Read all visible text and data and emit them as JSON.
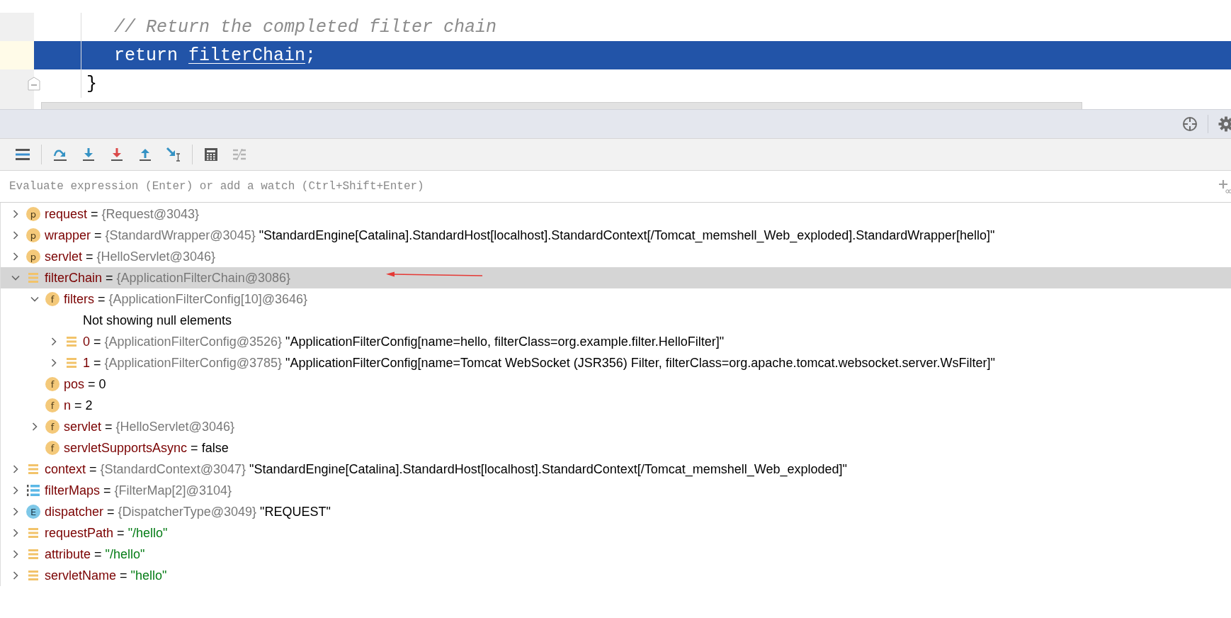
{
  "editor": {
    "lines": [
      {
        "selected": false,
        "segments": [
          {
            "kind": "comment",
            "text": "// Return the completed filter chain"
          }
        ]
      },
      {
        "selected": true,
        "segments": [
          {
            "kind": "keyword",
            "text": "return"
          },
          {
            "kind": "reference",
            "text": "filterChain"
          },
          {
            "kind": "plain",
            "text": ";"
          }
        ]
      },
      {
        "selected": false,
        "segments": [
          {
            "kind": "brace",
            "text": "}"
          }
        ]
      }
    ]
  },
  "evaluate": {
    "placeholder": "Evaluate expression (Enter) or add a watch (Ctrl+Shift+Enter)"
  },
  "variables": [
    {
      "kind": "parameter",
      "badge": "p",
      "name": "request",
      "operator": "=",
      "type_ref": "{Request@3043}",
      "expandable": true,
      "expanded": false,
      "selected": false
    },
    {
      "kind": "parameter",
      "badge": "p",
      "name": "wrapper",
      "operator": "=",
      "type_ref": "{StandardWrapper@3045}",
      "value": "\"StandardEngine[Catalina].StandardHost[localhost].StandardContext[/Tomcat_memshell_Web_exploded].StandardWrapper[hello]\"",
      "expandable": true,
      "expanded": false,
      "selected": false
    },
    {
      "kind": "parameter",
      "badge": "p",
      "name": "servlet",
      "operator": "=",
      "type_ref": "{HelloServlet@3046}",
      "expandable": true,
      "expanded": false,
      "selected": false
    },
    {
      "kind": "object",
      "name": "filterChain",
      "operator": "=",
      "type_ref": "{ApplicationFilterChain@3086}",
      "expandable": true,
      "expanded": true,
      "selected": true,
      "children": [
        {
          "kind": "field",
          "badge": "f",
          "name": "filters",
          "operator": "=",
          "type_ref": "{ApplicationFilterConfig[10]@3646}",
          "expandable": true,
          "expanded": true,
          "selected": false,
          "children": [
            {
              "kind": "note",
              "note": "Not showing null elements",
              "expandable": false,
              "selected": false
            },
            {
              "kind": "object",
              "name": "0",
              "operator": "=",
              "type_ref": "{ApplicationFilterConfig@3526}",
              "value": "\"ApplicationFilterConfig[name=hello, filterClass=org.example.filter.HelloFilter]\"",
              "expandable": true,
              "expanded": false,
              "selected": false
            },
            {
              "kind": "object",
              "name": "1",
              "operator": "=",
              "type_ref": "{ApplicationFilterConfig@3785}",
              "value": "\"ApplicationFilterConfig[name=Tomcat WebSocket (JSR356) Filter, filterClass=org.apache.tomcat.websocket.server.WsFilter]\"",
              "expandable": true,
              "expanded": false,
              "selected": false
            }
          ]
        },
        {
          "kind": "field",
          "badge": "f",
          "name": "pos",
          "operator": "=",
          "value": "0",
          "expandable": false,
          "selected": false
        },
        {
          "kind": "field",
          "badge": "f",
          "name": "n",
          "operator": "=",
          "value": "2",
          "expandable": false,
          "selected": false
        },
        {
          "kind": "field",
          "badge": "f",
          "name": "servlet",
          "operator": "=",
          "type_ref": "{HelloServlet@3046}",
          "expandable": true,
          "expanded": false,
          "selected": false
        },
        {
          "kind": "field",
          "badge": "f",
          "name": "servletSupportsAsync",
          "operator": "=",
          "value": "false",
          "expandable": false,
          "selected": false
        }
      ]
    },
    {
      "kind": "object",
      "name": "context",
      "operator": "=",
      "type_ref": "{StandardContext@3047}",
      "value": "\"StandardEngine[Catalina].StandardHost[localhost].StandardContext[/Tomcat_memshell_Web_exploded]\"",
      "expandable": true,
      "expanded": false,
      "selected": false
    },
    {
      "kind": "array",
      "name": "filterMaps",
      "operator": "=",
      "type_ref": "{FilterMap[2]@3104}",
      "expandable": true,
      "expanded": false,
      "selected": false
    },
    {
      "kind": "enum",
      "badge": "E",
      "name": "dispatcher",
      "operator": "=",
      "type_ref": "{DispatcherType@3049}",
      "value": "\"REQUEST\"",
      "expandable": true,
      "expanded": false,
      "selected": false
    },
    {
      "kind": "object",
      "name": "requestPath",
      "operator": "=",
      "string_value": "\"/hello\"",
      "expandable": true,
      "expanded": false,
      "selected": false
    },
    {
      "kind": "object",
      "name": "attribute",
      "operator": "=",
      "string_value": "\"/hello\"",
      "expandable": true,
      "expanded": false,
      "selected": false
    },
    {
      "kind": "object",
      "name": "servletName",
      "operator": "=",
      "string_value": "\"hello\"",
      "expandable": true,
      "expanded": false,
      "selected": false
    }
  ]
}
